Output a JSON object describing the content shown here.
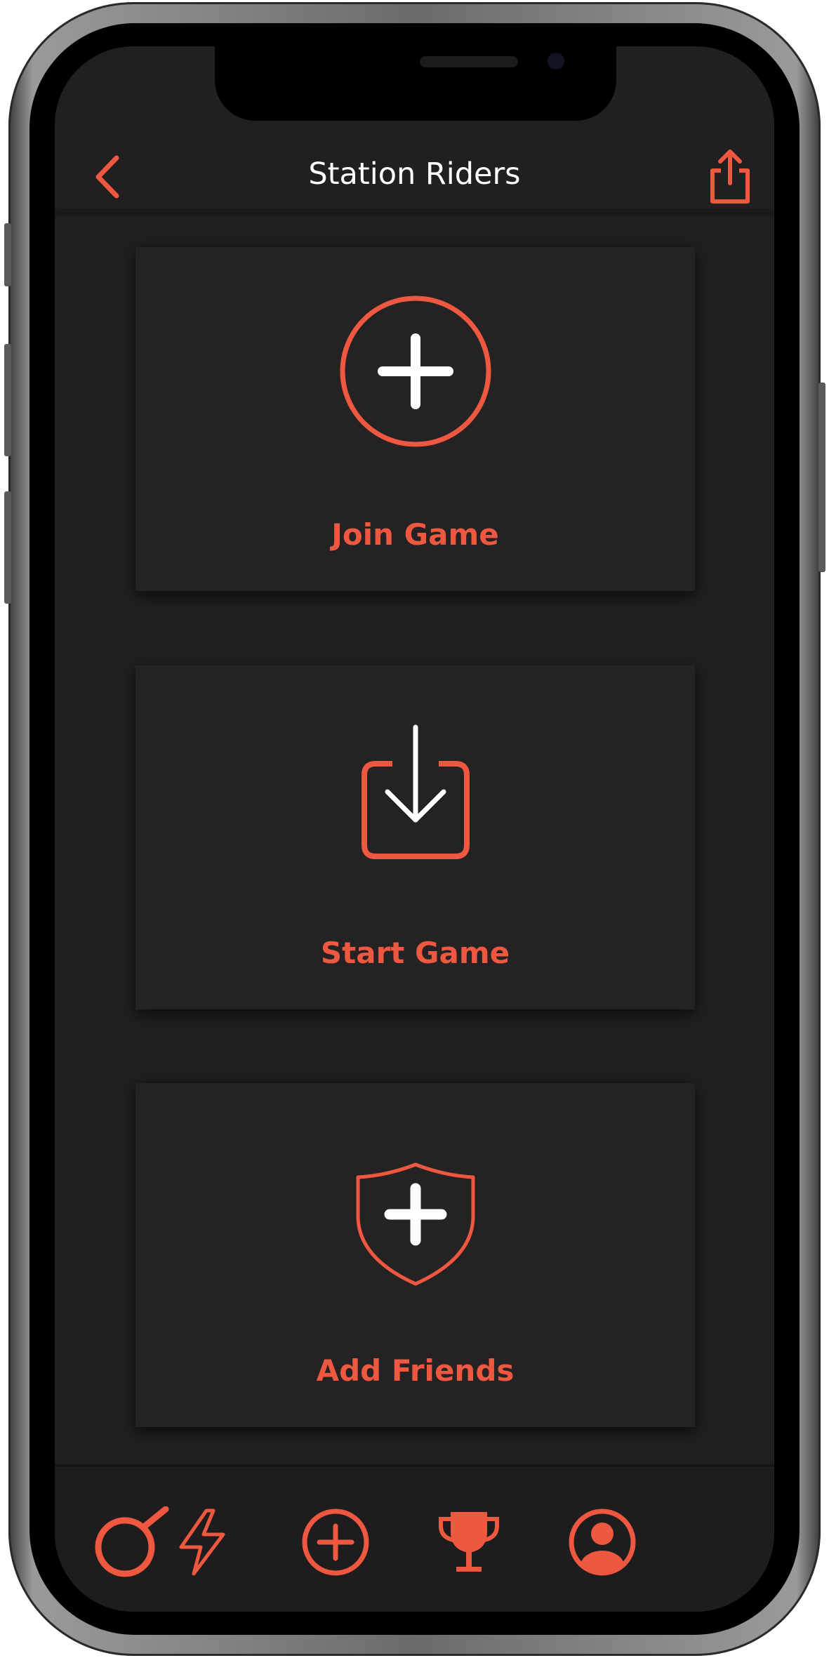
{
  "colors": {
    "accent": "#ee5840",
    "background": "#221f20",
    "card": "#252223",
    "title_text": "#ffffff"
  },
  "header": {
    "title": "Station Riders",
    "back_icon": "chevron-left-icon",
    "share_icon": "share-icon"
  },
  "cards": [
    {
      "label": "Join Game",
      "icon": "plus-circle-icon"
    },
    {
      "label": "Start Game",
      "icon": "download-tray-icon"
    },
    {
      "label": "Add Friends",
      "icon": "shield-plus-icon"
    }
  ],
  "tabbar": {
    "items": [
      {
        "icon": "search-icon"
      },
      {
        "icon": "lightning-icon"
      },
      {
        "icon": "plus-circle-icon"
      },
      {
        "icon": "trophy-icon"
      },
      {
        "icon": "profile-icon"
      }
    ]
  }
}
